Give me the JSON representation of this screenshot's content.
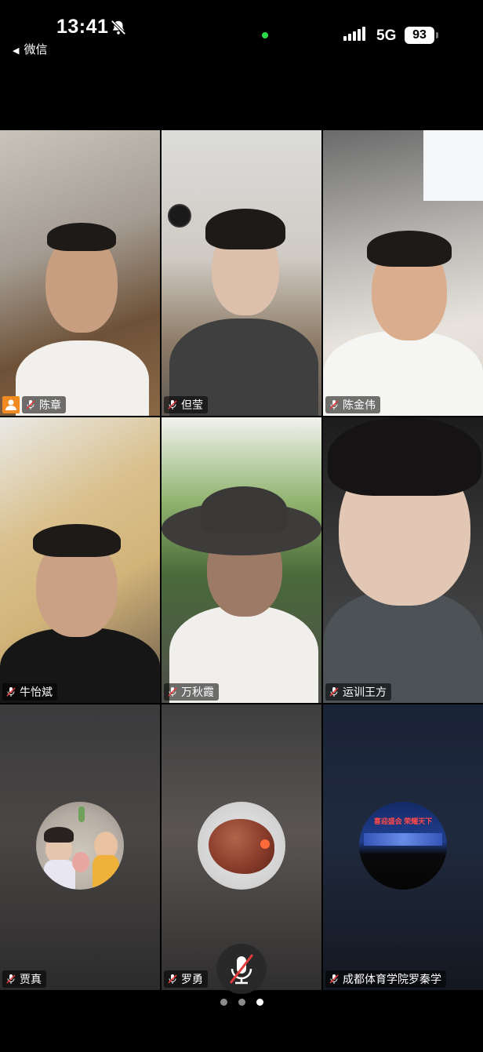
{
  "status_bar": {
    "time": "13:41",
    "back_app": "微信",
    "network": "5G",
    "battery": "93"
  },
  "participants": [
    {
      "name": "陈章",
      "host": true,
      "muted": true
    },
    {
      "name": "但莹",
      "muted": true
    },
    {
      "name": "陈金伟",
      "muted": true
    },
    {
      "name": "牛怡斌",
      "muted": true
    },
    {
      "name": "万秋霞",
      "muted": true
    },
    {
      "name": "运训王方",
      "muted": true
    },
    {
      "name": "贾真",
      "muted": true
    },
    {
      "name": "罗勇",
      "muted": true
    },
    {
      "name": "成都体育学院罗秦学",
      "muted": true
    }
  ],
  "avatar_banner_text": "喜迎盛会 荣耀天下",
  "pager": {
    "count": 3,
    "active": 3
  },
  "icons": [
    "bell-slash-icon",
    "cellular-signal-icon",
    "microphone-off-icon",
    "host-person-icon",
    "back-triangle-icon"
  ],
  "colors": {
    "host_badge": "#f08b22",
    "live_dot": "#2bd94a",
    "mute_slash": "#e33b3b"
  }
}
